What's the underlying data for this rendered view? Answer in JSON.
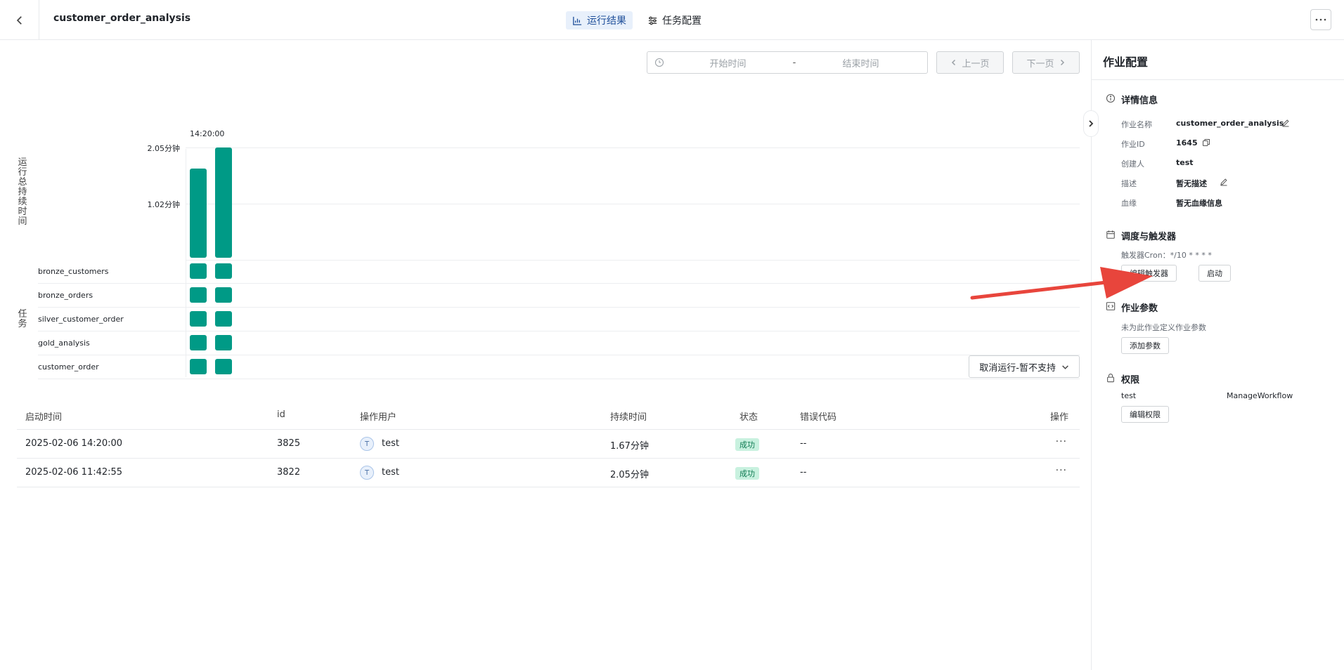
{
  "header": {
    "title": "customer_order_analysis",
    "tabs": [
      {
        "label": "运行结果",
        "active": true
      },
      {
        "label": "任务配置",
        "active": false
      }
    ]
  },
  "toolbar": {
    "start_placeholder": "开始时间",
    "separator": "-",
    "end_placeholder": "结束时间",
    "prev_label": "上一页",
    "next_label": "下一页"
  },
  "chart": {
    "y_title": "运行总持续时间",
    "task_title": "任务",
    "run_time_label": "14:20:00",
    "y_ticks": [
      "2.05分钟",
      "1.02分钟"
    ],
    "tasks": [
      "bronze_customers",
      "bronze_orders",
      "silver_customer_order",
      "gold_analysis",
      "customer_order"
    ]
  },
  "chart_data": {
    "type": "bar",
    "categories": [
      "2025-02-06 14:20:00",
      "2025-02-06 11:42:55"
    ],
    "values": [
      1.67,
      2.05
    ],
    "ylabel": "运行总持续时间",
    "y_ticks": [
      2.05,
      1.02
    ],
    "ylim": [
      0,
      2.05
    ],
    "units": "分钟",
    "color": "#009a86"
  },
  "cancel_button": "取消运行-暂不支持",
  "table": {
    "headers": {
      "start": "启动时间",
      "id": "id",
      "user": "操作用户",
      "duration": "持续时间",
      "status": "状态",
      "error": "错误代码",
      "action": "操作"
    },
    "rows": [
      {
        "start": "2025-02-06 14:20:00",
        "id": "3825",
        "avatar": "T",
        "user": "test",
        "duration": "1.67分钟",
        "status": "成功",
        "error": "--",
        "more": "···"
      },
      {
        "start": "2025-02-06 11:42:55",
        "id": "3822",
        "avatar": "T",
        "user": "test",
        "duration": "2.05分钟",
        "status": "成功",
        "error": "--",
        "more": "···"
      }
    ]
  },
  "side": {
    "title": "作业配置",
    "details": {
      "title": "详情信息",
      "name_label": "作业名称",
      "name_value": "customer_order_analysis",
      "id_label": "作业ID",
      "id_value": "1645",
      "creator_label": "创建人",
      "creator_value": "test",
      "desc_label": "描述",
      "desc_value": "暂无描述",
      "lineage_label": "血缘",
      "lineage_value": "暂无血缘信息"
    },
    "schedule": {
      "title": "调度与触发器",
      "cron_text": "触发器Cron：*/10 * * * *",
      "edit_trigger": "编辑触发器",
      "start": "启动"
    },
    "params": {
      "title": "作业参数",
      "empty_text": "未为此作业定义作业参数",
      "add": "添加参数"
    },
    "permissions": {
      "title": "权限",
      "user": "test",
      "role": "ManageWorkflow",
      "edit": "编辑权限"
    }
  },
  "colors": {
    "bar": "#009a86",
    "active_tab_bg": "#e8f0fb",
    "success_bg": "#c8f1df",
    "arrow": "#e8453c"
  }
}
